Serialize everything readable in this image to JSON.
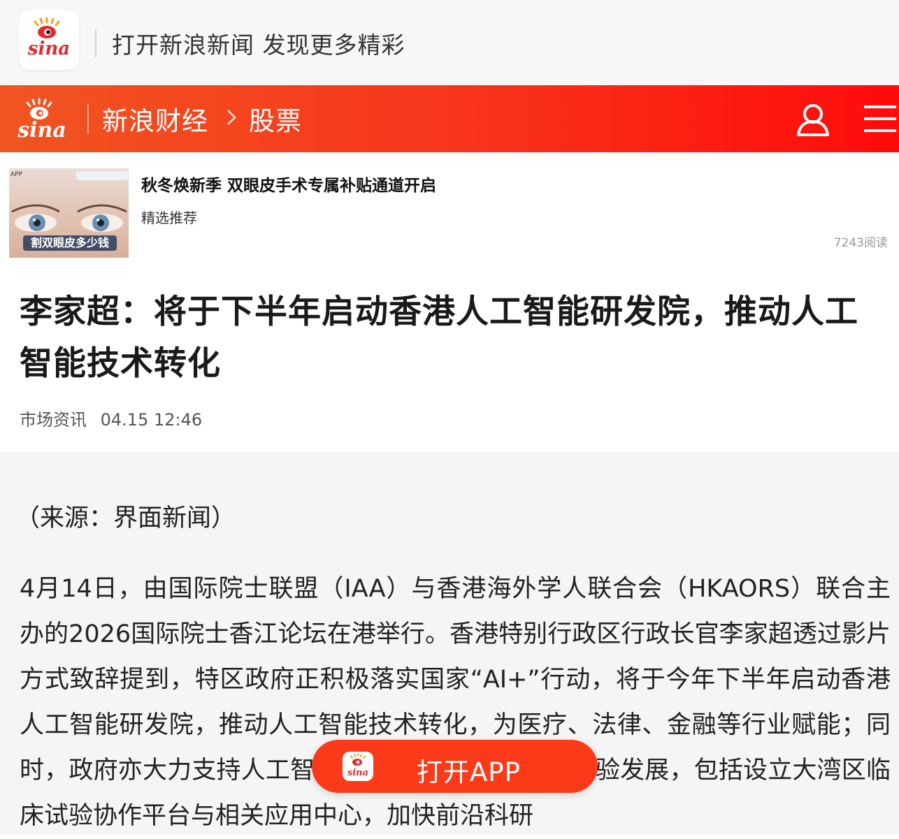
{
  "app_banner": {
    "logo_text": "sina",
    "text": "打开新浪新闻 发现更多精彩"
  },
  "header": {
    "logo_text": "sina",
    "breadcrumb": [
      "新浪财经",
      "股票"
    ],
    "breadcrumb_separator": ">",
    "icons": [
      "user-icon",
      "menu-icon"
    ],
    "accent_color": "#f8321a"
  },
  "ad": {
    "image_tag": "APP",
    "image_caption": "割双眼皮多少钱",
    "title": "秋冬焕新季 双眼皮手术专属补贴通道开启",
    "subtitle": "精选推荐",
    "reads": "7243阅读"
  },
  "article": {
    "title": "李家超：将于下半年启动香港人工智能研发院，推动人工智能技术转化",
    "source": "市场资讯",
    "datetime": "04.15 12:46",
    "source_line": "（来源：界面新闻）",
    "paragraph": "4月14日，由国际院士联盟（IAA）与香港海外学人联合会（HKAORS）联合主办的2026国际院士香江论坛在港举行。香港特别行政区行政长官李家超透过影片方式致辞提到，特区政府正积极落实国家“AI+”行动，将于今年下半年启动香港人工智能研发院，推动人工智能技术转化，为医疗、法律、金融等行业赋能；同时，政府亦大力支持人工智能、STEAM教育及临床试验发展，包括设立大湾区临床试验协作平台与相关应用中心，加快前沿科研"
  },
  "open_app": {
    "label": "打开APP",
    "logo_text": "sina"
  }
}
